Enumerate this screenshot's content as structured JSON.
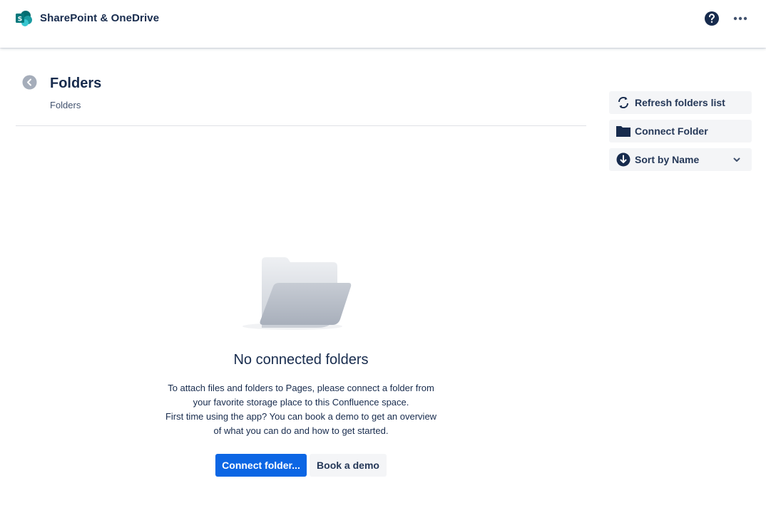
{
  "app": {
    "title": "SharePoint & OneDrive",
    "logo_icon": "sharepoint-logo-icon",
    "help_icon": "question-circle-icon",
    "more_icon": "more-horizontal-icon",
    "brand_color": "#038387"
  },
  "page": {
    "title": "Folders",
    "breadcrumb": "Folders",
    "back_icon": "chevron-left-circle-icon"
  },
  "sidebar": {
    "refresh_label": "Refresh folders list",
    "refresh_icon": "refresh-icon",
    "connect_label": "Connect Folder",
    "connect_icon": "folder-icon",
    "sort_label": "Sort by Name",
    "sort_icon": "arrow-down-circle-icon",
    "sort_dropdown_icon": "chevron-down-icon"
  },
  "empty_state": {
    "illustration": "empty-folder-illustration",
    "title": "No connected folders",
    "line1": "To attach files and folders to Pages, please connect a folder from",
    "line2": "your favorite storage place to this Confluence space.",
    "line3": "First time using the app? You can book a demo to get an overview",
    "line4": "of what you can do and how to get started.",
    "primary_button": "Connect folder...",
    "secondary_button": "Book a demo"
  },
  "colors": {
    "primary": "#0c66e4",
    "text": "#172b4d",
    "subtle_bg": "#f4f5f7"
  }
}
